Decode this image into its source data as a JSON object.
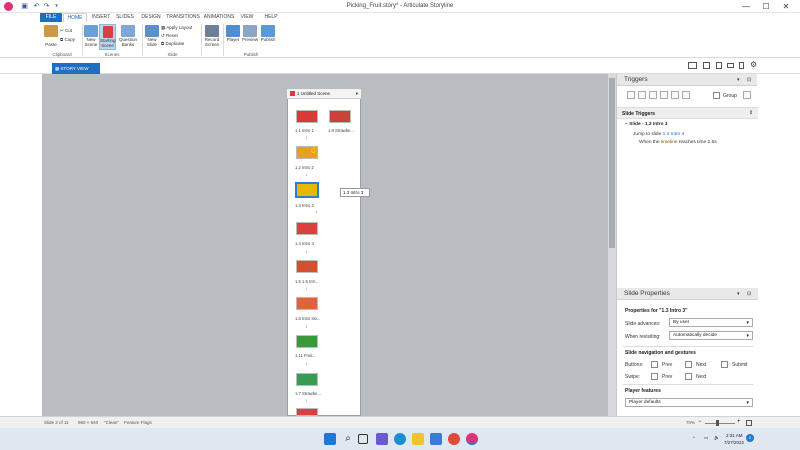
{
  "window": {
    "title": "Picking_Fruit.story* - Articulate Storyline",
    "minimize": "—",
    "maximize": "☐",
    "close": "✕"
  },
  "tabs": [
    "FILE",
    "HOME",
    "INSERT",
    "SLIDES",
    "DESIGN",
    "TRANSITIONS",
    "ANIMATIONS",
    "VIEW",
    "HELP"
  ],
  "ribbon": {
    "paste": "Paste",
    "cut": "Cut",
    "copy": "Copy",
    "clipboard": "Clipboard",
    "new_scene": "New Scene",
    "starting_scene": "Starting Scene",
    "question_banks": "Question Banks",
    "scenes": "Scenes",
    "new_slide": "New Slide",
    "apply_layout": "Apply Layout",
    "reset": "Reset",
    "duplicate": "Duplicate",
    "slide": "Slide",
    "record_screen": "Record Screen",
    "player": "Player",
    "preview": "Preview",
    "publish": "Publish",
    "publish_group": "Publish"
  },
  "story_view": {
    "tab_label": "STORY VIEW"
  },
  "scene": {
    "title": "1 Untitled Scene",
    "slides": [
      {
        "label": "1.1 Intro 1",
        "color": "#d83a3a"
      },
      {
        "label": "1.8 Strawbe...",
        "color": "#c9433a"
      },
      {
        "label": "1.2 Intro 2",
        "color": "#e8a020"
      },
      {
        "label": "1.3 Intro 3",
        "color": "#e6b800"
      },
      {
        "label": "1.4 Intro 4",
        "color": "#d94040"
      },
      {
        "label": "1.5 1.5 Intr...",
        "color": "#d05030"
      },
      {
        "label": "1.6 Intro slo...",
        "color": "#d8663a"
      },
      {
        "label": "1.11 Fruit...",
        "color": "#3a9a3a"
      },
      {
        "label": "1.7 Strawbe...",
        "color": "#3a9a50"
      },
      {
        "label": "",
        "color": "#d84040"
      }
    ],
    "tooltip": "1.3 Intro 3"
  },
  "triggers": {
    "title": "Triggers",
    "group_label": "Group",
    "section": "Slide Triggers",
    "slide_line": "Slide - 1.3 Intro 3",
    "action_prefix": "Jump to slide",
    "action_target": "1.4 Intro 4",
    "when_prefix": "When the",
    "when_object": "timeline",
    "when_suffix": "reaches time 2.5s"
  },
  "slide_properties": {
    "title": "Slide Properties",
    "properties_for": "Properties for \"1.3 Intro 3\"",
    "slide_advances_label": "Slide advances:",
    "slide_advances_value": "By user",
    "when_revisiting_label": "When revisiting:",
    "when_revisiting_value": "Automatically decide",
    "nav_title": "Slide navigation and gestures",
    "buttons_label": "Buttons:",
    "swipe_label": "Swipe:",
    "prev": "Prev",
    "next": "Next",
    "submit": "Submit",
    "player_features": "Player features",
    "player_defaults": "Player defaults"
  },
  "status": {
    "slide_count": "Slide 3 of 11",
    "dimensions": "960 × 540",
    "theme": "\"Clean\"",
    "feature_flags": "Feature Flags",
    "zoom": "70%"
  },
  "taskbar": {
    "time": "2:31 AM",
    "date": "7/27/2022",
    "notifications": "1"
  }
}
